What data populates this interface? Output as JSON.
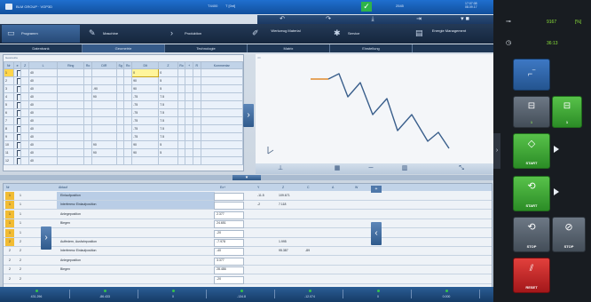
{
  "window": {
    "app_title": "BLM GROUP · VGP3D",
    "title_number": "T4400",
    "title_code": "T [0nt]",
    "top_right_code": "2545",
    "clock_time": "17:07:08",
    "clock_date": "08.09.17"
  },
  "toolbar": {
    "buttons": [
      "↶",
      "↷",
      "⤓",
      "⇥",
      "▾ ■"
    ]
  },
  "modes": [
    {
      "label": "Programm",
      "icon": "folder-icon",
      "active": true
    },
    {
      "label": "Maschine",
      "icon": "wrench-icon",
      "active": false
    },
    {
      "label": "Produktion",
      "icon": "play-icon",
      "active": false
    },
    {
      "label": "Werkzeug Material",
      "icon": "tool-icon",
      "active": false
    },
    {
      "label": "Service",
      "icon": "gear-icon",
      "active": false
    },
    {
      "label": "Energie Management",
      "icon": "energy-icon",
      "active": false
    }
  ],
  "subtabs": [
    "Datenbank",
    "Geometrie",
    "Technologie",
    "Matrix",
    "Einstellung"
  ],
  "active_subtab": 1,
  "geometry": {
    "caption": "Geometrie",
    "headers": [
      "Nr",
      "e",
      "Z",
      "L",
      "Ring",
      "Ro",
      "DIR",
      "Sg",
      "Ro",
      "Dlt",
      "Z",
      "Ro",
      "+",
      "R",
      "Kommentar"
    ],
    "rows": [
      {
        "nr": "1",
        "l": "40",
        "dir": "",
        "rg": "",
        "dlt": "0",
        "z": "0"
      },
      {
        "nr": "2",
        "l": "40",
        "dir": "",
        "rg": "",
        "dlt": "90",
        "z": "5"
      },
      {
        "nr": "3",
        "l": "40",
        "dir": "-90",
        "rg": "",
        "dlt": "90",
        "z": "5"
      },
      {
        "nr": "4",
        "l": "40",
        "dir": "90",
        "rg": "",
        "dlt": "-75",
        "z": "7.5"
      },
      {
        "nr": "5",
        "l": "40",
        "dir": "",
        "rg": "",
        "dlt": "-75",
        "z": "7.5"
      },
      {
        "nr": "6",
        "l": "40",
        "dir": "",
        "rg": "",
        "dlt": "-75",
        "z": "7.5"
      },
      {
        "nr": "7",
        "l": "40",
        "dir": "",
        "rg": "",
        "dlt": "-75",
        "z": "7.5"
      },
      {
        "nr": "8",
        "l": "40",
        "dir": "",
        "rg": "",
        "dlt": "-75",
        "z": "7.5"
      },
      {
        "nr": "9",
        "l": "40",
        "dir": "",
        "rg": "",
        "dlt": "-75",
        "z": "7.5"
      },
      {
        "nr": "10",
        "l": "40",
        "dir": "90",
        "rg": "",
        "dlt": "90",
        "z": "5"
      },
      {
        "nr": "11",
        "l": "40",
        "dir": "90",
        "rg": "",
        "dlt": "90",
        "z": "5"
      },
      {
        "nr": "12",
        "l": "40",
        "dir": "",
        "rg": "",
        "dlt": "",
        "z": ""
      }
    ]
  },
  "preview": {
    "tag": "3D"
  },
  "sequence": {
    "headers": [
      "Nr",
      "Ablauf",
      "Ex+",
      "Y",
      "Z",
      "C",
      "A",
      "W"
    ],
    "rows": [
      {
        "n1": "1",
        "n2": "1",
        "text": "Einlaufposition",
        "ex": "",
        "y": "-11.5",
        "z": "109.671",
        "c": "",
        "a": "",
        "yellow": true,
        "hl": true
      },
      {
        "n1": "1",
        "n2": "1",
        "text": "Interferenz Einlaufposition",
        "ex": "",
        "y": "-2",
        "z": "7.118",
        "c": "",
        "a": "",
        "yellow": true,
        "hl": true
      },
      {
        "n1": "1",
        "n2": "1",
        "text": "Anlegeposition",
        "ex": "2.377",
        "y": "",
        "z": "",
        "c": "",
        "a": "",
        "yellow": true,
        "hl": false
      },
      {
        "n1": "1",
        "n2": "1",
        "text": "Biegen",
        "ex": "24.651",
        "y": "",
        "z": "",
        "c": "",
        "a": "",
        "yellow": true,
        "hl": false
      },
      {
        "n1": "1",
        "n2": "1",
        "text": "",
        "ex": "-20",
        "y": "",
        "z": "",
        "c": "",
        "a": "",
        "yellow": true,
        "hl": false
      },
      {
        "n1": "2",
        "n2": "2",
        "text": "Auffedern, Ausfahrposition",
        "ex": "-7.978",
        "y": "",
        "z": "1.995",
        "c": "",
        "a": "",
        "yellow": true,
        "hl": false
      },
      {
        "n1": "2",
        "n2": "2",
        "text": "Interferenz Einlaufposition",
        "ex": "-40",
        "y": "",
        "z": "95.387",
        "c": "-89",
        "a": "",
        "yellow": false,
        "hl": false
      },
      {
        "n1": "2",
        "n2": "2",
        "text": "Anlegeposition",
        "ex": "3.377",
        "y": "",
        "z": "",
        "c": "",
        "a": "",
        "yellow": false,
        "hl": false
      },
      {
        "n1": "2",
        "n2": "2",
        "text": "Biegen",
        "ex": "28.486",
        "y": "",
        "z": "",
        "c": "",
        "a": "",
        "yellow": false,
        "hl": false
      },
      {
        "n1": "2",
        "n2": "2",
        "text": "",
        "ex": "-20",
        "y": "",
        "z": "",
        "c": "",
        "a": "",
        "yellow": false,
        "hl": false
      }
    ]
  },
  "statusbar": [
    "431.296",
    "-86.433",
    "0",
    "-134.8",
    "-12.074",
    "0",
    "0.000"
  ],
  "side": {
    "counter_label": "9167",
    "counter_value": "[%]",
    "timer_label": "36:13",
    "start_label": "START",
    "start2_label": "START",
    "stop_label": "STOP",
    "stop2_label": "STOP",
    "reset_label": "RESET",
    "colors": {
      "green": "#2b8c26",
      "red": "#a3171a",
      "accent": "#1f6fcf"
    }
  }
}
